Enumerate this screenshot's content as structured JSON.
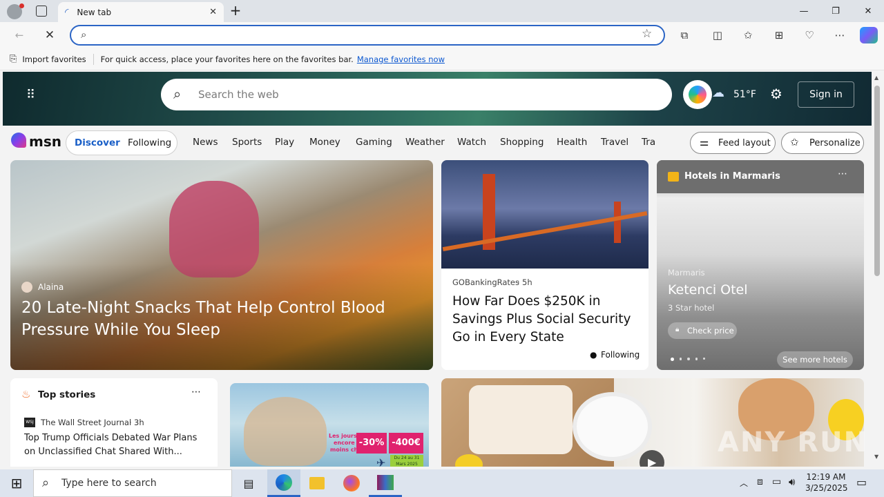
{
  "browser": {
    "tab_title": "New tab",
    "address_value": "",
    "favorites_bar": {
      "import_label": "Import favorites",
      "hint_text": "For quick access, place your favorites here on the favorites bar.",
      "manage_link": "Manage favorites now"
    }
  },
  "msn": {
    "logo_text": "msn",
    "search_placeholder": "Search the web",
    "weather_temp": "51°F",
    "sign_in": "Sign in",
    "toggle": {
      "discover": "Discover",
      "following": "Following"
    },
    "nav_items": [
      "News",
      "Sports",
      "Play",
      "Money",
      "Gaming",
      "Weather",
      "Watch",
      "Shopping",
      "Health",
      "Travel",
      "Tra"
    ],
    "feed_layout": "Feed layout",
    "personalize": "Personalize",
    "cards": {
      "main": {
        "author": "Alaina",
        "headline": "20 Late-Night Snacks That Help Control Blood Pressure While You Sleep"
      },
      "bridge": {
        "source": "GOBankingRates",
        "age": "5h",
        "headline": "How Far Does $250K in Savings Plus Social Security Go in Every State",
        "follow_state": "Following"
      },
      "hotel": {
        "header": "Hotels in Marmaris",
        "location": "Marmaris",
        "name": "Ketenci Otel",
        "stars": "3 Star hotel",
        "check_price": "Check price",
        "see_more": "See more hotels"
      },
      "top_stories": {
        "title": "Top stories",
        "source": "The Wall Street Journal",
        "source_badge": "WSJ",
        "age": "3h",
        "headline": "Top Trump Officials Debated War Plans on Unclassified Chat Shared With..."
      },
      "ad": {
        "line1": "Les jours",
        "line2": "encore",
        "line3": "moins chers",
        "pct": "-30%",
        "eur": "-400€",
        "dates": "Du 24 au 31 Mars 2025"
      }
    }
  },
  "watermark": "ANY RUN",
  "taskbar": {
    "search_placeholder": "Type here to search",
    "time": "12:19 AM",
    "date": "3/25/2025"
  },
  "colors": {
    "accent": "#2a64c5",
    "taskbar": "#dde4ee"
  }
}
